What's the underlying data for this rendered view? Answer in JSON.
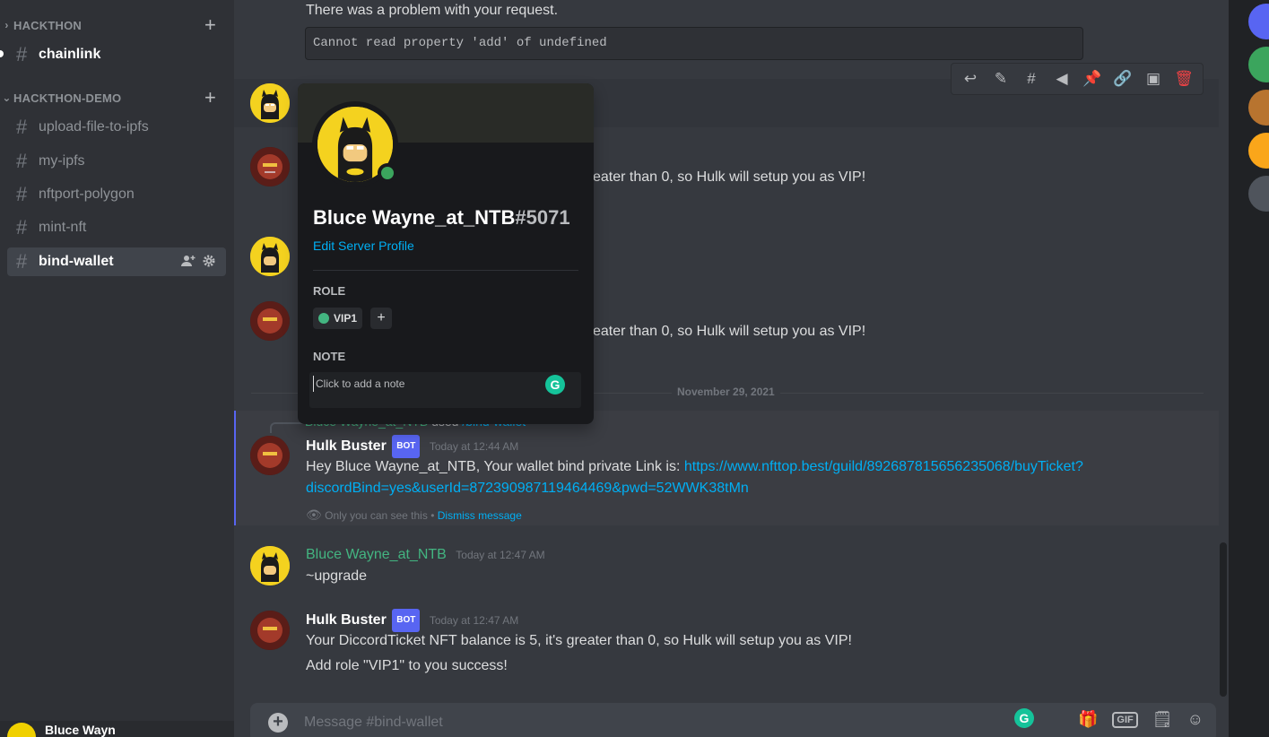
{
  "sidebar": {
    "categories": [
      {
        "label": "HACKTHON"
      },
      {
        "label": "HACKTHON-DEMO"
      }
    ],
    "channels": [
      {
        "label": "chainlink"
      },
      {
        "label": "upload-file-to-ipfs"
      },
      {
        "label": "my-ipfs"
      },
      {
        "label": "nftport-polygon"
      },
      {
        "label": "mint-nft"
      },
      {
        "label": "bind-wallet"
      }
    ],
    "user_panel": {
      "name": "Bluce Wayn"
    }
  },
  "chat": {
    "top_message": {
      "text": "There was a problem with your request.",
      "code": "Cannot read property 'add' of undefined"
    },
    "partial_messages": [
      {
        "text": "eater than 0, so Hulk will setup you as VIP!"
      },
      {
        "text": "eater than 0, so Hulk will setup you as VIP!"
      }
    ],
    "date_divider": "November 29, 2021",
    "reply_preview": {
      "user": "Bluce Wayne_at_NTB",
      "used": "used",
      "command": "/bind-wallet"
    },
    "messages": [
      {
        "author": "Hulk Buster",
        "badge": "BOT",
        "timestamp": "Today at 12:44 AM",
        "text": "Hey Bluce Wayne_at_NTB, Your wallet bind private Link is: ",
        "link_line1": "https://www.nfttop.best/guild/892687815656235068/buyTicket?",
        "link_line2": "discordBind=yes&userId=872390987119464469&pwd=52WWK38tMn",
        "ephemeral_note": "Only you can see this",
        "bullet": "•",
        "dismiss": "Dismiss message"
      },
      {
        "author": "Bluce Wayne_at_NTB",
        "timestamp": "Today at 12:47 AM",
        "text": "~upgrade"
      },
      {
        "author": "Hulk Buster",
        "badge": "BOT",
        "timestamp": "Today at 12:47 AM",
        "text": "Your DiccordTicket NFT balance is 5, it's greater than 0, so Hulk will setup you as VIP!",
        "text2": "Add role \"VIP1\" to you success!"
      }
    ],
    "composer": {
      "placeholder": "Message #bind-wallet",
      "gif": "GIF"
    }
  },
  "popout": {
    "username": "Bluce Wayne_at_NTB",
    "discriminator": "#5071",
    "edit_profile": "Edit Server Profile",
    "role_header": "ROLE",
    "role": "VIP1",
    "add_role": "+",
    "note_header": "NOTE",
    "note_placeholder": "Click to add a note"
  },
  "colors": {
    "accent": "#5865f2",
    "link": "#00aff4",
    "online": "#3ba55d",
    "danger": "#ed4245"
  },
  "icons": [
    "reply-icon",
    "edit-icon",
    "thread-icon",
    "tag-icon",
    "pin-icon",
    "link-icon",
    "id-icon",
    "trash-icon",
    "gift-icon",
    "sticker-icon",
    "emoji-icon",
    "add-icon",
    "eye-icon",
    "gear-icon",
    "add-member-icon"
  ]
}
